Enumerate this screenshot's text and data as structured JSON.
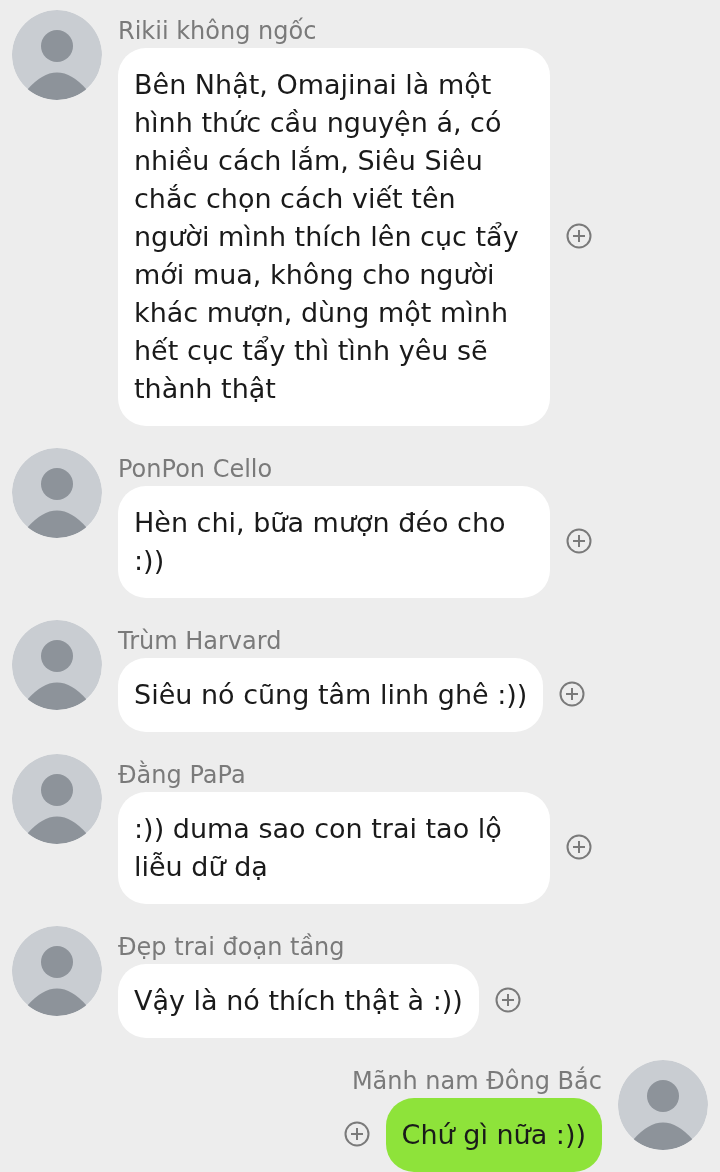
{
  "messages": [
    {
      "sender": "Rikii không ngốc",
      "text": "Bên Nhật, Omajinai là một hình thức cầu nguyện á, có nhiều cách lắm, Siêu Siêu chắc chọn cách viết tên người mình thích lên cục tẩy mới mua, không cho người khác mượn, dùng một mình hết cục tẩy thì tình yêu sẽ thành thật",
      "outgoing": false
    },
    {
      "sender": "PonPon Cello",
      "text": "Hèn chi, bữa mượn đéo cho :))",
      "outgoing": false
    },
    {
      "sender": "Trùm Harvard",
      "text": "Siêu nó cũng tâm linh ghê :))",
      "outgoing": false
    },
    {
      "sender": "Đằng PaPa",
      "text": ":)) duma sao con trai tao lộ liễu dữ dạ",
      "outgoing": false
    },
    {
      "sender": "Đẹp trai đoạn tầng",
      "text": "Vậy là nó thích thật à :))",
      "outgoing": false
    },
    {
      "sender": "Mãnh nam Đông Bắc",
      "text": "Chứ gì nữa :))",
      "outgoing": true
    }
  ]
}
